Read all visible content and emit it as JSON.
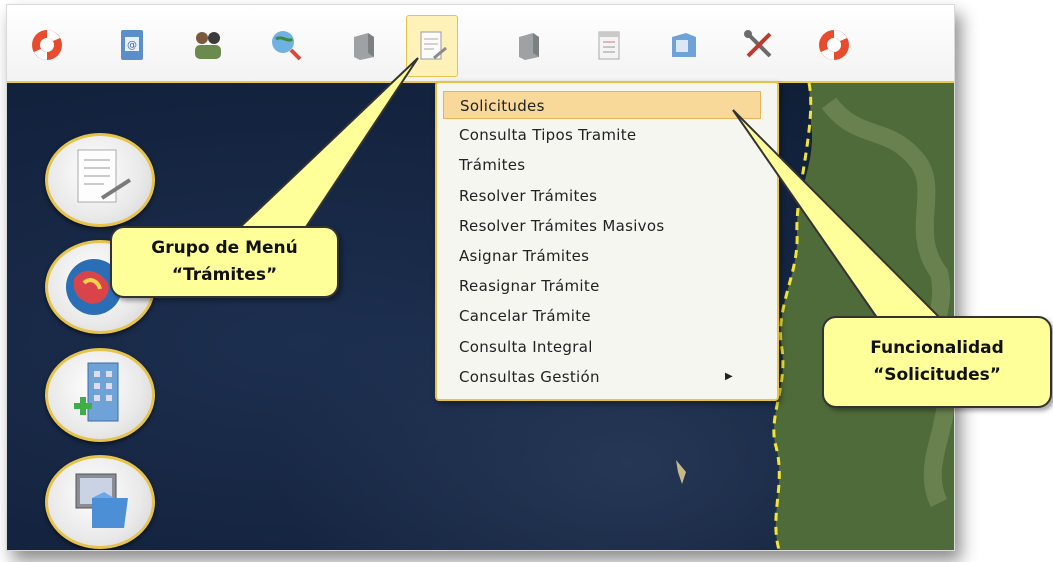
{
  "toolbar": {
    "icons": [
      {
        "name": "lifebuoy-icon"
      },
      {
        "name": "address-book-icon"
      },
      {
        "name": "users-icon"
      },
      {
        "name": "globe-search-icon"
      },
      {
        "name": "gray-box-icon"
      },
      {
        "name": "document-edit-icon"
      },
      {
        "name": "gray-box-icon"
      },
      {
        "name": "notepad-icon"
      },
      {
        "name": "folder-window-icon"
      },
      {
        "name": "tools-icon"
      },
      {
        "name": "lifebuoy-icon"
      }
    ],
    "active_index": 5
  },
  "menu": {
    "items": [
      {
        "label": "Solicitudes",
        "selected": true
      },
      {
        "label": "Consulta Tipos Tramite"
      },
      {
        "label": "Trámites"
      },
      {
        "label": "Resolver Trámites"
      },
      {
        "label": "Resolver Trámites Masivos"
      },
      {
        "label": "Asignar Trámites"
      },
      {
        "label": "Reasignar Trámite"
      },
      {
        "label": "Cancelar Trámite"
      },
      {
        "label": "Consulta Integral"
      },
      {
        "label": "Consultas Gestión",
        "submenu": true
      }
    ]
  },
  "side_buttons": [
    {
      "name": "document-sign-icon"
    },
    {
      "name": "globe-icon"
    },
    {
      "name": "building-add-icon"
    },
    {
      "name": "folder-computer-icon"
    }
  ],
  "callouts": {
    "group": {
      "line1": "Grupo de Menú",
      "line2": "“Trámites”"
    },
    "function": {
      "line1": "Funcionalidad",
      "line2": "“Solicitudes”"
    }
  },
  "colors": {
    "accent": "#e6c34a",
    "callout_bg": "#ffff99",
    "selected_bg": "#f9d99a",
    "map_sea": "#142440"
  }
}
